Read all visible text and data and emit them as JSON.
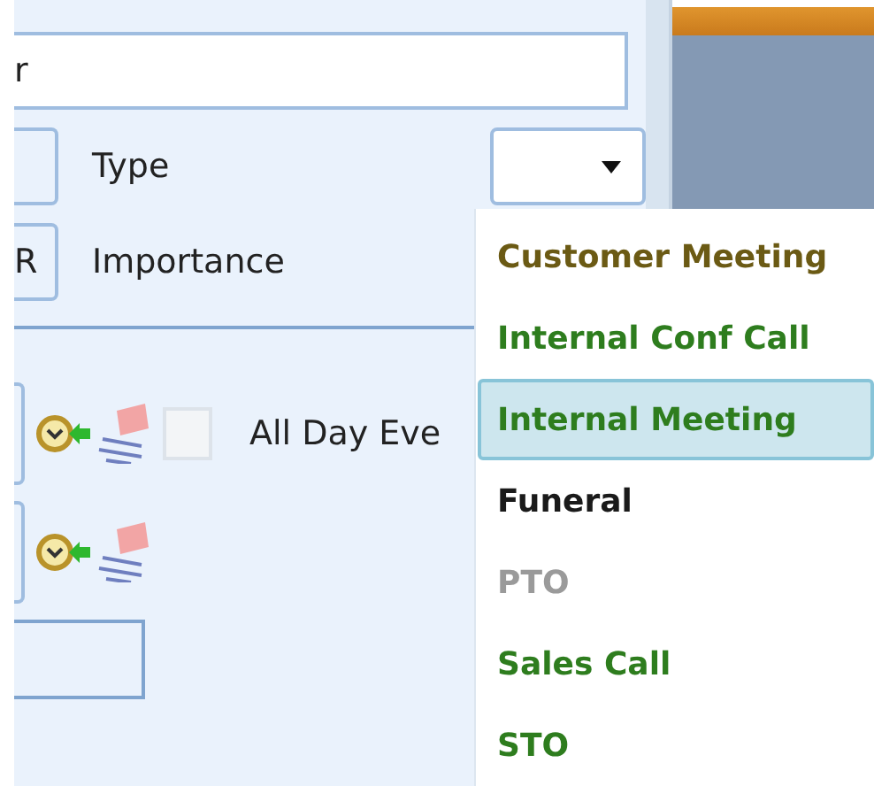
{
  "subject_field": {
    "value": "r"
  },
  "type_row": {
    "label": "Type"
  },
  "importance_row": {
    "button": "R",
    "label": "Importance"
  },
  "all_day": {
    "checked": false,
    "label": "All Day Eve"
  },
  "type_dropdown": {
    "items": [
      {
        "label": "Customer Meeting",
        "color": "#6b5a14",
        "selected": false
      },
      {
        "label": "Internal Conf Call",
        "color": "#2e7d1e",
        "selected": false
      },
      {
        "label": "Internal Meeting",
        "color": "#2e7d1e",
        "selected": true
      },
      {
        "label": "Funeral",
        "color": "#1a1a1a",
        "selected": false
      },
      {
        "label": "PTO",
        "color": "#9a9a9a",
        "selected": false
      },
      {
        "label": "Sales Call",
        "color": "#2e7d1e",
        "selected": false
      },
      {
        "label": "STO",
        "color": "#2e7d1e",
        "selected": false
      }
    ]
  }
}
